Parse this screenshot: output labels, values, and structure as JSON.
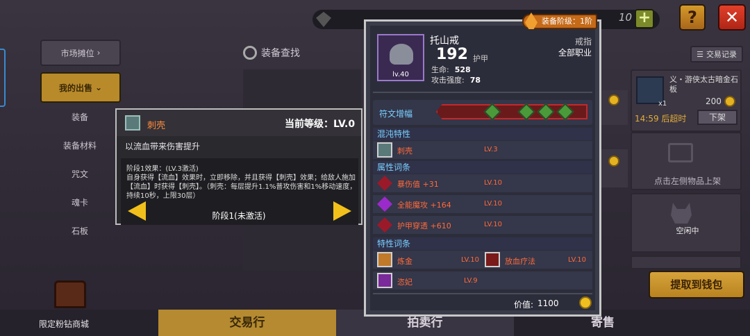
{
  "topbar": {
    "coin_count": "10",
    "plus_label": "+",
    "help_label": "?",
    "close_label": "✕"
  },
  "nav": {
    "market_stall": "市场摊位",
    "my_sales": "我的出售",
    "sub_items": [
      "装备",
      "装备材料",
      "咒文",
      "魂卡",
      "石板"
    ]
  },
  "search": {
    "label": "装备查找"
  },
  "right": {
    "record_label": "交易记录",
    "card1": {
      "name": "义・游侠太古暗金石板",
      "count": "x1",
      "price": "200",
      "time": "14:59 后超时",
      "off_label": "下架"
    },
    "empty_hint": "点击左侧物品上架",
    "idle_label": "空闲中",
    "extract_label": "提取到钱包"
  },
  "bottom": {
    "mall_label": "限定粉钻商城",
    "tabs": [
      "交易行",
      "拍卖行",
      "寄售"
    ]
  },
  "skill_tip": {
    "name": "刺壳",
    "level_label": "当前等级：LV.0",
    "description": "以流血带来伤害提升",
    "stage_title": "阶段1效果：(LV.3激活)",
    "effect_text": "自身获得【流血】效果时，立即移除，并且获得【刺壳】效果；给敌人施加【流血】时获得【刺壳】。（刺壳：每层提升1.1%普攻伤害和1%移动速度，持续10秒，上限30层）",
    "stage_label": "阶段1(未激活)"
  },
  "equipment": {
    "tier_badge": "装备阶级：1阶",
    "name": "托山戒",
    "armor_value": "192",
    "armor_label": "护甲",
    "type": "戒指",
    "class": "全部职业",
    "level": "lv.40",
    "stats": [
      {
        "label": "生命:",
        "value": "528"
      },
      {
        "label": "攻击强度:",
        "value": "78"
      }
    ],
    "rune_label": "符文增幅",
    "chaos_title": "混沌特性",
    "chaos": {
      "name": "刺壳",
      "lv": "LV.3"
    },
    "attr_title": "属性词条",
    "attrs": [
      {
        "name": "暴伤值 +31",
        "lv": "LV.10"
      },
      {
        "name": "全能魔攻 +164",
        "lv": "LV.10"
      },
      {
        "name": "护甲穿透 +610",
        "lv": "LV.10"
      }
    ],
    "trait_title": "特性词条",
    "traits": [
      {
        "name": "炼金",
        "lv": "LV.10"
      },
      {
        "name": "放血疗法",
        "lv": "LV.10"
      },
      {
        "name": "恣妃",
        "lv": "LV.9"
      }
    ],
    "price_label": "价值:",
    "price_value": "1100"
  },
  "colors": {
    "accent_gold": "#b88a2a",
    "close_red": "#e0402a",
    "chaos_orange": "#ff6a3a",
    "section_blue": "#7ad0ff"
  }
}
